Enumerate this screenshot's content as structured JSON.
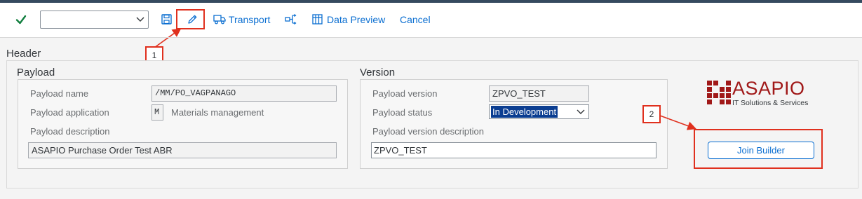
{
  "toolbar": {
    "command_field_value": "",
    "transport_label": "Transport",
    "data_preview_label": "Data Preview",
    "cancel_label": "Cancel"
  },
  "annotations": {
    "callout_1": "1",
    "callout_2": "2"
  },
  "header": {
    "title": "Header"
  },
  "payload": {
    "title": "Payload",
    "name_label": "Payload name",
    "name_value": "/MM/PO_VAGPANAGO",
    "application_label": "Payload application",
    "application_code": "M",
    "application_text": "Materials management",
    "description_label": "Payload description",
    "description_value": "ASAPIO Purchase Order Test ABR"
  },
  "version": {
    "title": "Version",
    "version_label": "Payload version",
    "version_value": "ZPVO_TEST",
    "status_label": "Payload status",
    "status_value": "In Development",
    "description_label": "Payload version description",
    "description_value": "ZPVO_TEST"
  },
  "logo": {
    "name": "ASAPIO",
    "tagline": "IT Solutions & Services",
    "color": "#a01818"
  },
  "join_builder_label": "Join Builder",
  "colors": {
    "accent": "#0a6ed1",
    "annotation_red": "#e0301e",
    "shell_bar": "#354a5f",
    "confirm_green": "#107e3e"
  }
}
